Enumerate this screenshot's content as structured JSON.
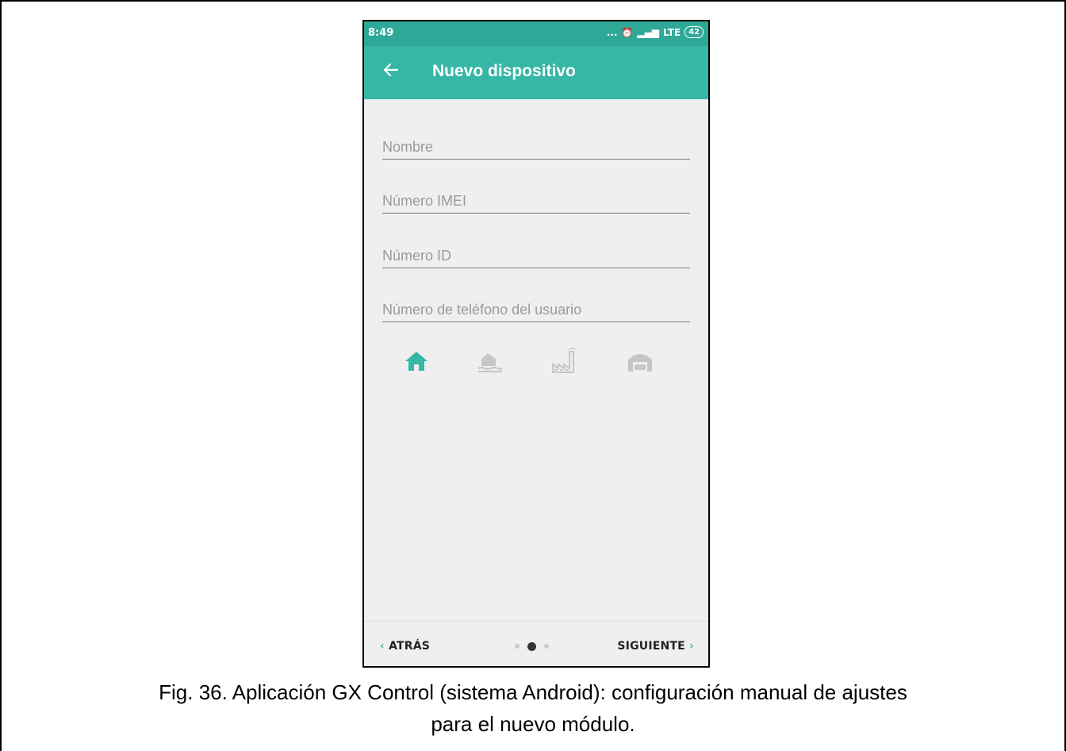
{
  "status_bar": {
    "time": "8:49",
    "indicators": "...",
    "network": "LTE",
    "battery": "42",
    "icons": [
      "alarm-off-icon",
      "alarm-clock-icon",
      "signal-icon",
      "battery-icon"
    ]
  },
  "app_bar": {
    "title": "Nuevo dispositivo",
    "back_icon": "arrow-left-icon"
  },
  "form": {
    "fields": [
      {
        "placeholder": "Nombre",
        "value": ""
      },
      {
        "placeholder": "Número IMEI",
        "value": ""
      },
      {
        "placeholder": "Número ID",
        "value": ""
      },
      {
        "placeholder": "Número de teléfono del usuario",
        "value": ""
      }
    ],
    "object_types": [
      {
        "icon": "house-icon",
        "selected": true
      },
      {
        "icon": "lake-house-icon",
        "selected": false
      },
      {
        "icon": "factory-icon",
        "selected": false
      },
      {
        "icon": "garage-icon",
        "selected": false
      }
    ]
  },
  "bottom_nav": {
    "back_label": "ATRÁS",
    "next_label": "SIGUIENTE",
    "pages": 3,
    "current_page": 2
  },
  "caption": {
    "line1": "Fig. 36. Aplicación GX Control (sistema Android): configuración manual de ajustes",
    "line2": "para el nuevo módulo."
  },
  "colors": {
    "accent": "#36b7a5",
    "status_bar": "#2ea897",
    "background": "#efefef",
    "inactive_icon": "#c6c6c6"
  }
}
